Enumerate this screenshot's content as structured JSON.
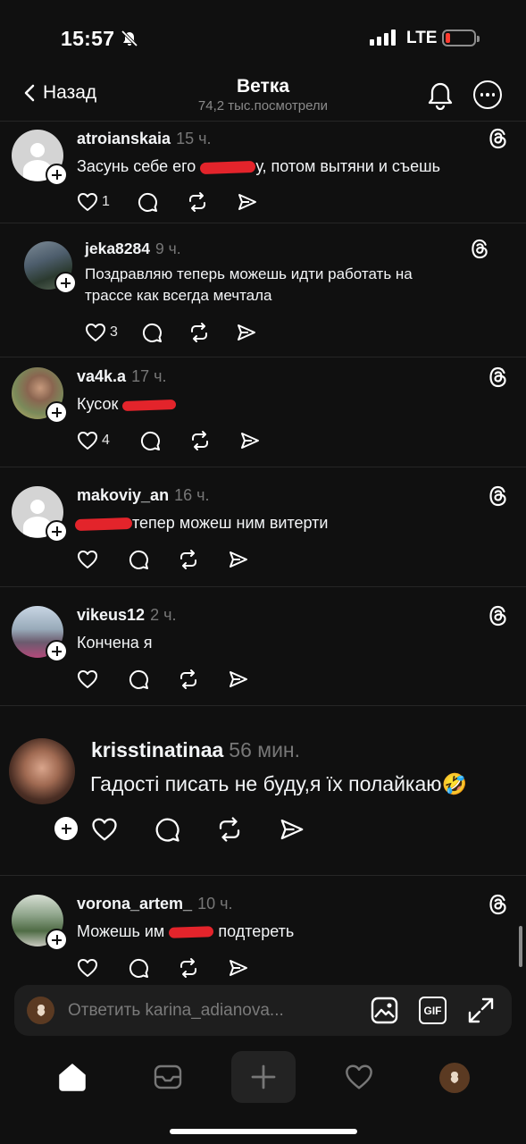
{
  "status": {
    "time": "15:57",
    "network": "LTE"
  },
  "header": {
    "back_label": "Назад",
    "title": "Ветка",
    "subtitle": "74,2 тыс.посмотрели"
  },
  "posts": [
    {
      "username": "atroianskaia",
      "time": "15 ч.",
      "text_before": "Засунь себе его",
      "text_after": "у, потом вытяни и съешь",
      "likes": "1"
    },
    {
      "username": "jeka8284",
      "time": "9 ч.",
      "text_line1": "Поздравляю теперь можешь идти работать на",
      "text_line2": "трассе как всегда мечтала",
      "likes": "3"
    },
    {
      "username": "va4k.a",
      "time": "17 ч.",
      "text_before": "Кусок",
      "likes": "4"
    },
    {
      "username": "makoviy_an",
      "time": "16 ч.",
      "text_after": "тепер можеш ним витерти"
    },
    {
      "username": "vikeus12",
      "time": "2 ч.",
      "text": "Кончена я"
    },
    {
      "username": "krisstinatinaa",
      "time": "56 мин.",
      "text": "Гадості писать не буду,я їх полайкаю",
      "emoji": "🤣"
    },
    {
      "username": "vorona_artem_",
      "time": "10 ч.",
      "text_before": "Можешь им",
      "text_after": "подтереть"
    }
  ],
  "reply": {
    "placeholder": "Ответить karina_adianova...",
    "gif_label": "GIF"
  },
  "tabs": [
    "home",
    "inbox",
    "create",
    "activity",
    "profile"
  ],
  "colors": {
    "background": "#101010",
    "redaction": "#e3242b",
    "muted": "#777777"
  }
}
